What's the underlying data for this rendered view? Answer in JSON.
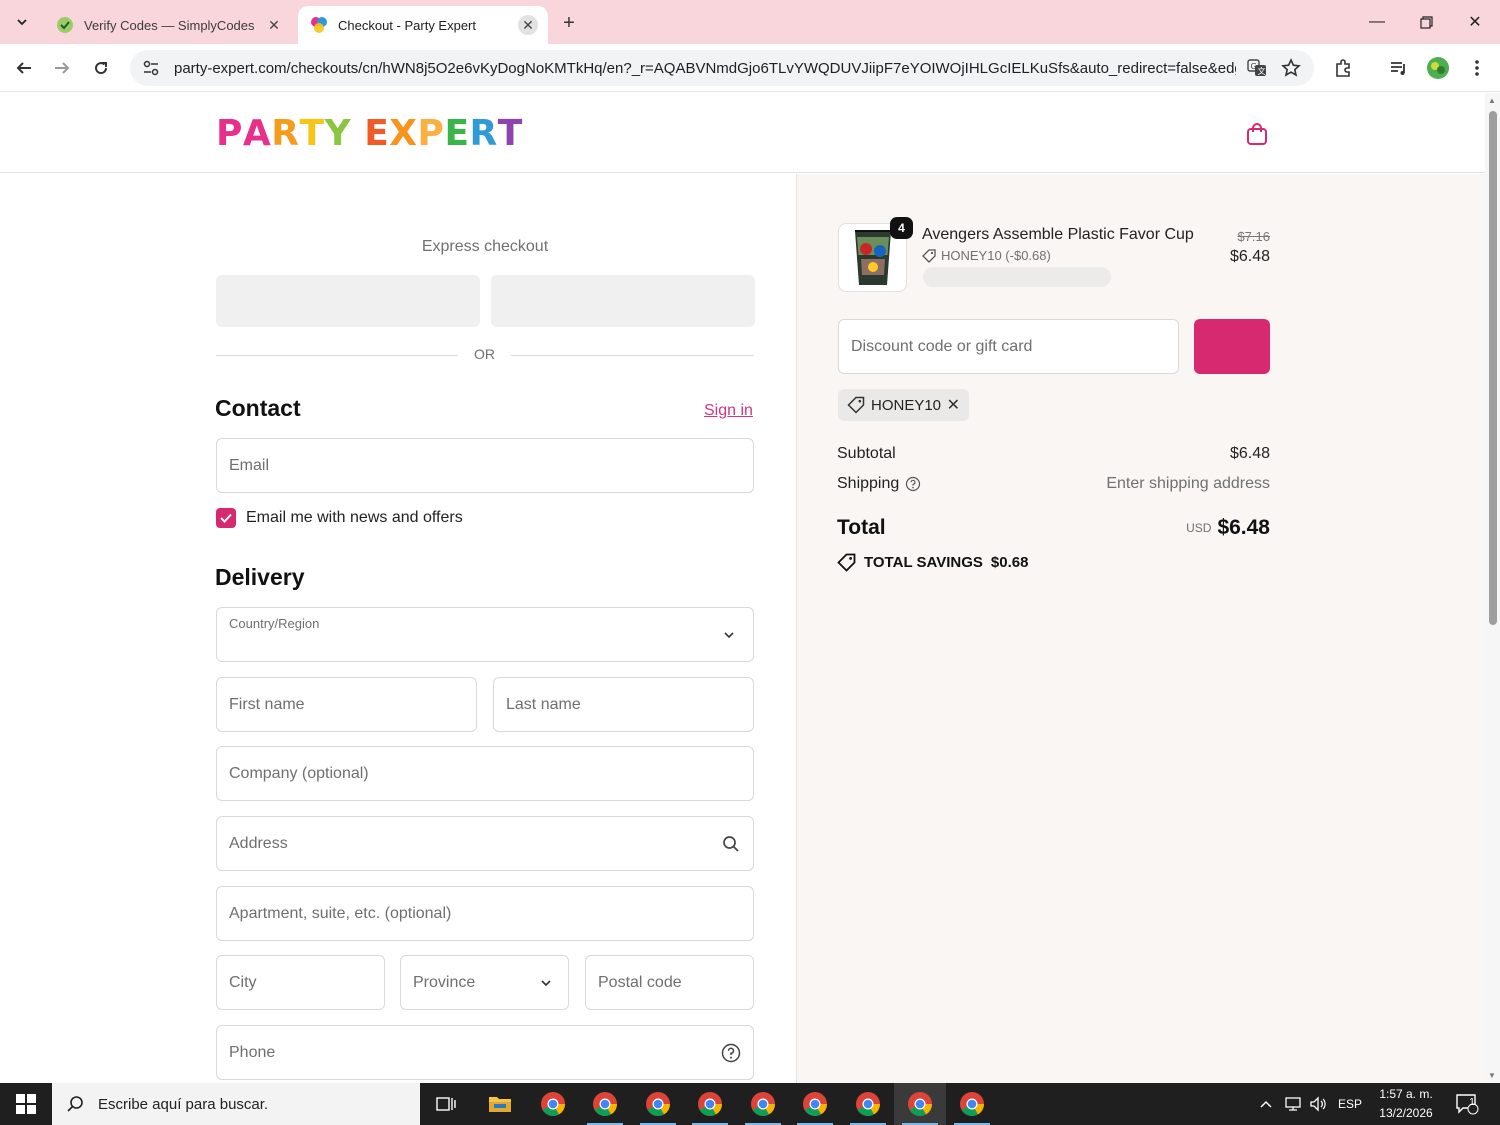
{
  "browser": {
    "tabs": [
      {
        "title": "Verify Codes — SimplyCodes",
        "active": false
      },
      {
        "title": "Checkout - Party Expert",
        "active": true
      }
    ],
    "url": "party-expert.com/checkouts/cn/hWN8j5O2e6vKyDogNoKMTkHq/en?_r=AQABVNmdGjo6TLvYWQDUVJiipF7eYOIWOjIHLGcIELKuSfs&auto_redirect=false&edge..."
  },
  "header": {
    "logo_letters": [
      "P",
      "A",
      "R",
      "T",
      "Y",
      " ",
      "E",
      "X",
      "P",
      "E",
      "R",
      "T"
    ],
    "logo_colors": [
      "#e8308a",
      "#e8308a",
      "#f39c1e",
      "#f5c518",
      "#8cc63f",
      "#ffffff",
      "#f15a29",
      "#f7941d",
      "#fbb040",
      "#39b54a",
      "#2e9bd6",
      "#8e44ad"
    ]
  },
  "checkout": {
    "express_label": "Express checkout",
    "or_label": "OR",
    "contact_title": "Contact",
    "sign_in": "Sign in",
    "email_placeholder": "Email",
    "newsletter_label": "Email me with news and offers",
    "delivery_title": "Delivery",
    "country_label": "Country/Region",
    "first_name": "First name",
    "last_name": "Last name",
    "company": "Company (optional)",
    "address": "Address",
    "apartment": "Apartment, suite, etc. (optional)",
    "city": "City",
    "province": "Province",
    "postal": "Postal code",
    "phone": "Phone"
  },
  "summary": {
    "product_name": "Avengers Assemble Plastic Favor Cup",
    "quantity": "4",
    "product_discount": "HONEY10 (-$0.68)",
    "price_original": "$7.16",
    "price_current": "$6.48",
    "discount_placeholder": "Discount code or gift card",
    "applied_code": "HONEY10",
    "subtotal_label": "Subtotal",
    "subtotal_value": "$6.48",
    "shipping_label": "Shipping",
    "shipping_value": "Enter shipping address",
    "total_label": "Total",
    "currency": "USD",
    "total_value": "$6.48",
    "savings_label": "TOTAL SAVINGS",
    "savings_value": "$0.68"
  },
  "taskbar": {
    "search_placeholder": "Escribe aquí para buscar.",
    "lang": "ESP",
    "time": "1:57 a. m.",
    "date": "13/2/2026",
    "notifications": "1"
  },
  "colors": {
    "accent": "#d6296f",
    "tabbar": "#f9d5dc"
  }
}
